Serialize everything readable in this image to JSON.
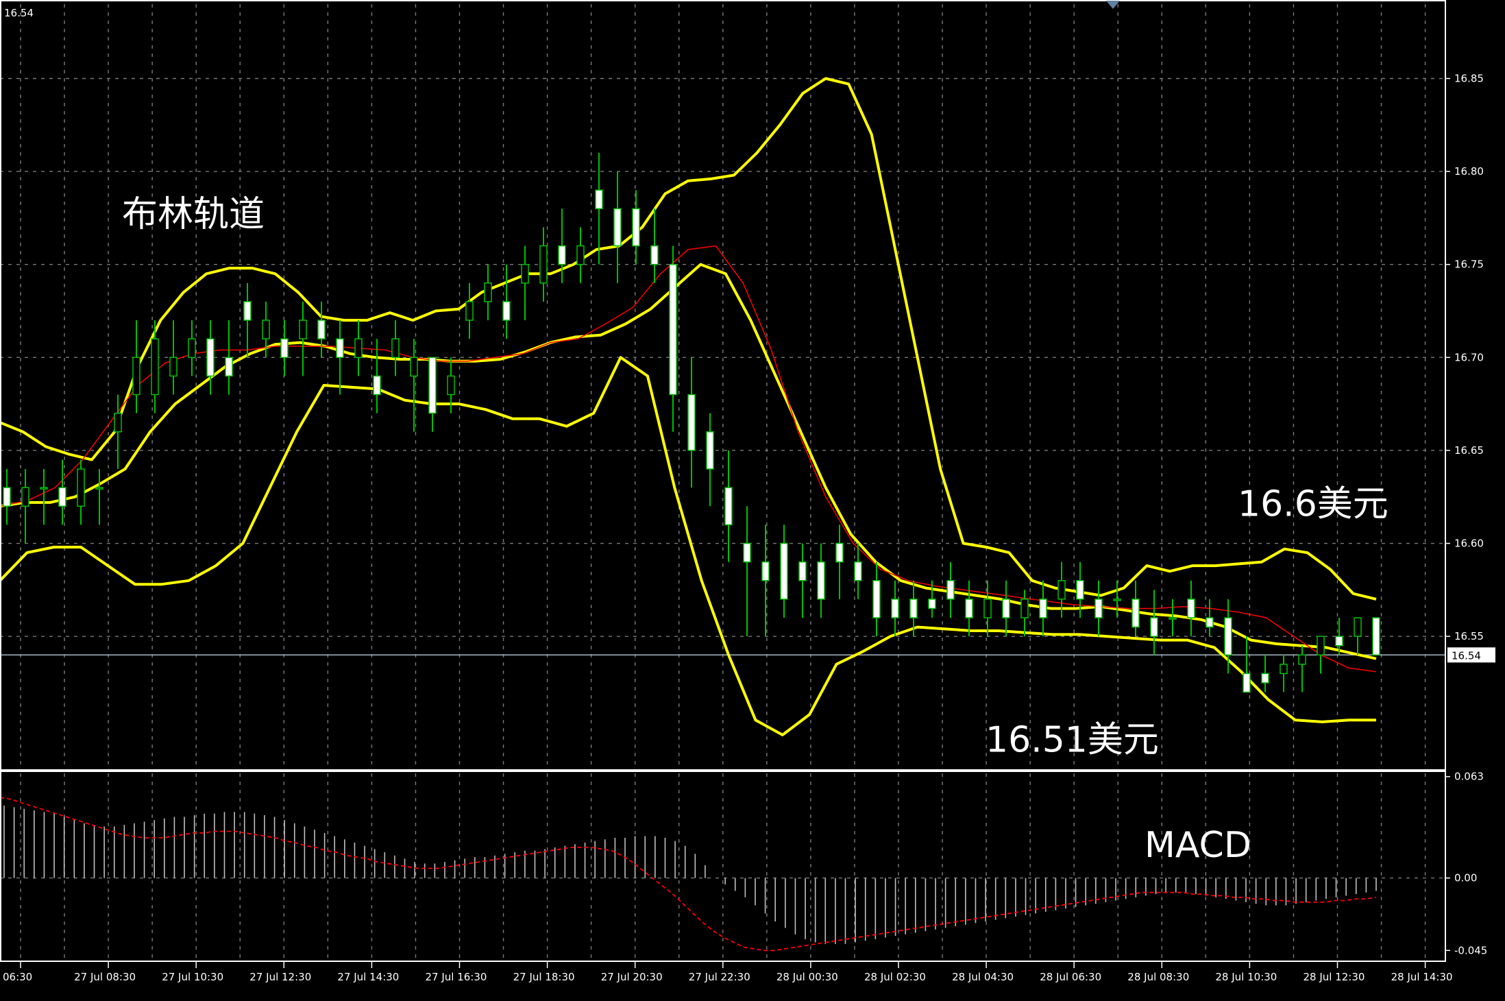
{
  "chart_data": [
    {
      "type": "candlestick",
      "panel": "price",
      "title": "布林轨道",
      "corner_price": "16.54",
      "current_price": 16.54,
      "current_price_label": "16.54",
      "ylim": [
        16.48,
        16.89
      ],
      "yticks": [
        16.55,
        16.6,
        16.65,
        16.7,
        16.75,
        16.8,
        16.85
      ],
      "ytick_labels": [
        "16.55",
        "16.60",
        "16.65",
        "16.70",
        "16.75",
        "16.80",
        "16.85"
      ],
      "xticks": [
        "06:30",
        "27 Jul 08:30",
        "27 Jul 10:30",
        "27 Jul 12:30",
        "27 Jul 14:30",
        "27 Jul 16:30",
        "27 Jul 18:30",
        "27 Jul 20:30",
        "27 Jul 22:30",
        "28 Jul 00:30",
        "28 Jul 02:30",
        "28 Jul 04:30",
        "28 Jul 06:30",
        "28 Jul 08:30",
        "28 Jul 10:30",
        "28 Jul 12:30",
        "28 Jul 14:30"
      ],
      "grid": true,
      "colors": {
        "candle": "#00c000",
        "candle_body_up": "#000000",
        "candle_body_down": "#ffffff",
        "bollinger": "#ffff00",
        "ma": "#ff0000",
        "grid": "#808080",
        "background": "#000000"
      },
      "annotations": [
        {
          "text": "16.6美元",
          "price": 16.6
        },
        {
          "text": "16.51美元",
          "price": 16.51
        }
      ],
      "bollinger_upper": [
        16.665,
        16.66,
        16.652,
        16.648,
        16.645,
        16.66,
        16.695,
        16.72,
        16.735,
        16.745,
        16.748,
        16.748,
        16.745,
        16.735,
        16.722,
        16.72,
        16.72,
        16.724,
        16.72,
        16.725,
        16.726,
        16.735,
        16.74,
        16.745,
        16.745,
        16.75,
        16.758,
        16.76,
        16.77,
        16.788,
        16.795,
        16.796,
        16.798,
        16.81,
        16.825,
        16.842,
        16.85,
        16.847,
        16.82,
        16.76,
        16.7,
        16.64,
        16.6,
        16.598,
        16.595,
        16.58,
        16.576,
        16.574,
        16.572,
        16.576,
        16.588,
        16.585,
        16.588,
        16.588,
        16.589,
        16.59,
        16.597,
        16.595,
        16.586,
        16.573,
        16.57
      ],
      "bollinger_middle": [
        16.62,
        16.622,
        16.622,
        16.625,
        16.632,
        16.64,
        16.66,
        16.675,
        16.685,
        16.695,
        16.702,
        16.707,
        16.708,
        16.706,
        16.702,
        16.7,
        16.699,
        16.699,
        16.698,
        16.698,
        16.699,
        16.703,
        16.708,
        16.711,
        16.712,
        16.718,
        16.726,
        16.738,
        16.75,
        16.745,
        16.72,
        16.69,
        16.66,
        16.63,
        16.605,
        16.59,
        16.58,
        16.576,
        16.574,
        16.572,
        16.57,
        16.567,
        16.565,
        16.565,
        16.566,
        16.564,
        16.562,
        16.561,
        16.559,
        16.555,
        16.548,
        16.546,
        16.545,
        16.544,
        16.541,
        16.538
      ],
      "bollinger_lower": [
        16.58,
        16.595,
        16.598,
        16.598,
        16.588,
        16.578,
        16.578,
        16.58,
        16.588,
        16.6,
        16.63,
        16.66,
        16.685,
        16.684,
        16.683,
        16.677,
        16.675,
        16.675,
        16.672,
        16.667,
        16.667,
        16.663,
        16.67,
        16.7,
        16.69,
        16.63,
        16.58,
        16.54,
        16.505,
        16.497,
        16.508,
        16.535,
        16.542,
        16.55,
        16.555,
        16.554,
        16.553,
        16.553,
        16.552,
        16.551,
        16.551,
        16.55,
        16.549,
        16.548,
        16.548,
        16.544,
        16.531,
        16.516,
        16.505,
        16.504,
        16.505,
        16.505
      ],
      "ma": [
        16.62,
        16.623,
        16.63,
        16.645,
        16.665,
        16.685,
        16.697,
        16.702,
        16.704,
        16.704,
        16.706,
        16.706,
        16.706,
        16.705,
        16.704,
        16.7,
        16.698,
        16.698,
        16.7,
        16.702,
        16.708,
        16.71,
        16.718,
        16.727,
        16.745,
        16.758,
        16.76,
        16.74,
        16.705,
        16.66,
        16.625,
        16.6,
        16.586,
        16.58,
        16.577,
        16.575,
        16.573,
        16.571,
        16.569,
        16.567,
        16.566,
        16.565,
        16.565,
        16.566,
        16.565,
        16.563,
        16.56,
        16.55,
        16.54,
        16.533,
        16.531
      ],
      "candles": [
        {
          "o": 16.63,
          "h": 16.64,
          "l": 16.61,
          "c": 16.62
        },
        {
          "o": 16.62,
          "h": 16.64,
          "l": 16.6,
          "c": 16.63
        },
        {
          "o": 16.63,
          "h": 16.64,
          "l": 16.61,
          "c": 16.63
        },
        {
          "o": 16.63,
          "h": 16.645,
          "l": 16.61,
          "c": 16.62
        },
        {
          "o": 16.62,
          "h": 16.645,
          "l": 16.61,
          "c": 16.64
        },
        {
          "o": 16.63,
          "h": 16.64,
          "l": 16.61,
          "c": 16.63
        },
        {
          "o": 16.66,
          "h": 16.68,
          "l": 16.64,
          "c": 16.67
        },
        {
          "o": 16.68,
          "h": 16.72,
          "l": 16.67,
          "c": 16.7
        },
        {
          "o": 16.68,
          "h": 16.72,
          "l": 16.67,
          "c": 16.71
        },
        {
          "o": 16.69,
          "h": 16.72,
          "l": 16.68,
          "c": 16.7
        },
        {
          "o": 16.7,
          "h": 16.72,
          "l": 16.69,
          "c": 16.71
        },
        {
          "o": 16.71,
          "h": 16.72,
          "l": 16.68,
          "c": 16.69
        },
        {
          "o": 16.7,
          "h": 16.72,
          "l": 16.68,
          "c": 16.69
        },
        {
          "o": 16.73,
          "h": 16.74,
          "l": 16.7,
          "c": 16.72
        },
        {
          "o": 16.71,
          "h": 16.73,
          "l": 16.7,
          "c": 16.72
        },
        {
          "o": 16.71,
          "h": 16.72,
          "l": 16.69,
          "c": 16.7
        },
        {
          "o": 16.71,
          "h": 16.73,
          "l": 16.69,
          "c": 16.72
        },
        {
          "o": 16.72,
          "h": 16.73,
          "l": 16.7,
          "c": 16.71
        },
        {
          "o": 16.71,
          "h": 16.72,
          "l": 16.68,
          "c": 16.7
        },
        {
          "o": 16.7,
          "h": 16.72,
          "l": 16.69,
          "c": 16.71
        },
        {
          "o": 16.69,
          "h": 16.71,
          "l": 16.67,
          "c": 16.68
        },
        {
          "o": 16.7,
          "h": 16.72,
          "l": 16.69,
          "c": 16.71
        },
        {
          "o": 16.69,
          "h": 16.71,
          "l": 16.66,
          "c": 16.7
        },
        {
          "o": 16.7,
          "h": 16.7,
          "l": 16.66,
          "c": 16.67
        },
        {
          "o": 16.68,
          "h": 16.7,
          "l": 16.67,
          "c": 16.69
        },
        {
          "o": 16.72,
          "h": 16.74,
          "l": 16.71,
          "c": 16.73
        },
        {
          "o": 16.73,
          "h": 16.75,
          "l": 16.72,
          "c": 16.74
        },
        {
          "o": 16.73,
          "h": 16.75,
          "l": 16.71,
          "c": 16.72
        },
        {
          "o": 16.74,
          "h": 16.76,
          "l": 16.72,
          "c": 16.75
        },
        {
          "o": 16.74,
          "h": 16.77,
          "l": 16.73,
          "c": 16.76
        },
        {
          "o": 16.76,
          "h": 16.78,
          "l": 16.74,
          "c": 16.75
        },
        {
          "o": 16.75,
          "h": 16.77,
          "l": 16.74,
          "c": 16.76
        },
        {
          "o": 16.79,
          "h": 16.81,
          "l": 16.75,
          "c": 16.78
        },
        {
          "o": 16.78,
          "h": 16.8,
          "l": 16.74,
          "c": 16.76
        },
        {
          "o": 16.78,
          "h": 16.79,
          "l": 16.75,
          "c": 16.76
        },
        {
          "o": 16.76,
          "h": 16.78,
          "l": 16.74,
          "c": 16.75
        },
        {
          "o": 16.75,
          "h": 16.76,
          "l": 16.66,
          "c": 16.68
        },
        {
          "o": 16.68,
          "h": 16.7,
          "l": 16.63,
          "c": 16.65
        },
        {
          "o": 16.66,
          "h": 16.67,
          "l": 16.62,
          "c": 16.64
        },
        {
          "o": 16.63,
          "h": 16.65,
          "l": 16.59,
          "c": 16.61
        },
        {
          "o": 16.6,
          "h": 16.62,
          "l": 16.55,
          "c": 16.59
        },
        {
          "o": 16.59,
          "h": 16.61,
          "l": 16.55,
          "c": 16.58
        },
        {
          "o": 16.6,
          "h": 16.61,
          "l": 16.56,
          "c": 16.57
        },
        {
          "o": 16.59,
          "h": 16.6,
          "l": 16.56,
          "c": 16.58
        },
        {
          "o": 16.59,
          "h": 16.6,
          "l": 16.56,
          "c": 16.57
        },
        {
          "o": 16.6,
          "h": 16.61,
          "l": 16.57,
          "c": 16.59
        },
        {
          "o": 16.59,
          "h": 16.6,
          "l": 16.57,
          "c": 16.58
        },
        {
          "o": 16.58,
          "h": 16.59,
          "l": 16.55,
          "c": 16.56
        },
        {
          "o": 16.57,
          "h": 16.58,
          "l": 16.55,
          "c": 16.56
        },
        {
          "o": 16.57,
          "h": 16.58,
          "l": 16.55,
          "c": 16.56
        },
        {
          "o": 16.57,
          "h": 16.58,
          "l": 16.56,
          "c": 16.565
        },
        {
          "o": 16.58,
          "h": 16.59,
          "l": 16.56,
          "c": 16.57
        },
        {
          "o": 16.57,
          "h": 16.58,
          "l": 16.55,
          "c": 16.56
        },
        {
          "o": 16.56,
          "h": 16.58,
          "l": 16.55,
          "c": 16.57
        },
        {
          "o": 16.57,
          "h": 16.58,
          "l": 16.55,
          "c": 16.56
        },
        {
          "o": 16.56,
          "h": 16.575,
          "l": 16.55,
          "c": 16.57
        },
        {
          "o": 16.57,
          "h": 16.58,
          "l": 16.55,
          "c": 16.56
        },
        {
          "o": 16.57,
          "h": 16.59,
          "l": 16.56,
          "c": 16.58
        },
        {
          "o": 16.58,
          "h": 16.59,
          "l": 16.56,
          "c": 16.57
        },
        {
          "o": 16.57,
          "h": 16.58,
          "l": 16.55,
          "c": 16.56
        },
        {
          "o": 16.57,
          "h": 16.58,
          "l": 16.56,
          "c": 16.57
        },
        {
          "o": 16.57,
          "h": 16.58,
          "l": 16.55,
          "c": 16.555
        },
        {
          "o": 16.56,
          "h": 16.575,
          "l": 16.54,
          "c": 16.55
        },
        {
          "o": 16.56,
          "h": 16.57,
          "l": 16.55,
          "c": 16.56
        },
        {
          "o": 16.57,
          "h": 16.58,
          "l": 16.55,
          "c": 16.56
        },
        {
          "o": 16.56,
          "h": 16.57,
          "l": 16.55,
          "c": 16.555
        },
        {
          "o": 16.56,
          "h": 16.57,
          "l": 16.53,
          "c": 16.54
        },
        {
          "o": 16.53,
          "h": 16.55,
          "l": 16.52,
          "c": 16.52
        },
        {
          "o": 16.53,
          "h": 16.54,
          "l": 16.52,
          "c": 16.525
        },
        {
          "o": 16.53,
          "h": 16.54,
          "l": 16.52,
          "c": 16.535
        },
        {
          "o": 16.535,
          "h": 16.545,
          "l": 16.52,
          "c": 16.54
        },
        {
          "o": 16.54,
          "h": 16.55,
          "l": 16.53,
          "c": 16.55
        },
        {
          "o": 16.55,
          "h": 16.56,
          "l": 16.54,
          "c": 16.545
        },
        {
          "o": 16.55,
          "h": 16.56,
          "l": 16.54,
          "c": 16.56
        },
        {
          "o": 16.56,
          "h": 16.56,
          "l": 16.54,
          "c": 16.54
        }
      ]
    },
    {
      "type": "bar",
      "panel": "macd",
      "title": "MACD",
      "ylim": [
        -0.05,
        0.065
      ],
      "yticks": [
        0.063,
        0.0,
        -0.045
      ],
      "ytick_labels": [
        "0.063",
        "0.00",
        "-0.045"
      ],
      "colors": {
        "histogram": "#c0c0c0",
        "signal": "#ff0000"
      },
      "histogram": [
        0.045,
        0.044,
        0.043,
        0.042,
        0.041,
        0.04,
        0.038,
        0.036,
        0.034,
        0.033,
        0.032,
        0.032,
        0.033,
        0.034,
        0.035,
        0.036,
        0.037,
        0.038,
        0.038,
        0.039,
        0.04,
        0.04,
        0.041,
        0.041,
        0.041,
        0.04,
        0.039,
        0.038,
        0.036,
        0.034,
        0.032,
        0.03,
        0.028,
        0.026,
        0.024,
        0.022,
        0.02,
        0.018,
        0.016,
        0.014,
        0.012,
        0.01,
        0.009,
        0.009,
        0.01,
        0.011,
        0.012,
        0.013,
        0.013,
        0.014,
        0.015,
        0.016,
        0.017,
        0.017,
        0.018,
        0.019,
        0.02,
        0.021,
        0.022,
        0.023,
        0.024,
        0.025,
        0.025,
        0.026,
        0.026,
        0.026,
        0.025,
        0.023,
        0.02,
        0.015,
        0.008,
        0.0,
        -0.004,
        -0.008,
        -0.012,
        -0.017,
        -0.022,
        -0.027,
        -0.031,
        -0.035,
        -0.038,
        -0.04,
        -0.041,
        -0.041,
        -0.041,
        -0.04,
        -0.039,
        -0.038,
        -0.037,
        -0.036,
        -0.035,
        -0.034,
        -0.033,
        -0.032,
        -0.031,
        -0.03,
        -0.029,
        -0.028,
        -0.027,
        -0.026,
        -0.025,
        -0.024,
        -0.023,
        -0.022,
        -0.021,
        -0.02,
        -0.019,
        -0.018,
        -0.017,
        -0.016,
        -0.015,
        -0.014,
        -0.013,
        -0.012,
        -0.011,
        -0.01,
        -0.009,
        -0.009,
        -0.009,
        -0.01,
        -0.011,
        -0.012,
        -0.013,
        -0.014,
        -0.015,
        -0.016,
        -0.017,
        -0.017,
        -0.017,
        -0.016,
        -0.015,
        -0.014,
        -0.013,
        -0.012,
        -0.011,
        -0.01,
        -0.009,
        -0.008
      ],
      "signal": [
        0.05,
        0.049,
        0.047,
        0.045,
        0.043,
        0.041,
        0.039,
        0.037,
        0.035,
        0.033,
        0.031,
        0.029,
        0.027,
        0.026,
        0.025,
        0.025,
        0.025,
        0.026,
        0.027,
        0.028,
        0.028,
        0.029,
        0.029,
        0.029,
        0.028,
        0.027,
        0.026,
        0.025,
        0.023,
        0.022,
        0.02,
        0.019,
        0.017,
        0.016,
        0.014,
        0.013,
        0.012,
        0.01,
        0.009,
        0.008,
        0.007,
        0.006,
        0.006,
        0.006,
        0.007,
        0.008,
        0.009,
        0.01,
        0.011,
        0.012,
        0.013,
        0.014,
        0.015,
        0.016,
        0.017,
        0.018,
        0.019,
        0.019,
        0.019,
        0.018,
        0.017,
        0.014,
        0.01,
        0.005,
        0.0,
        -0.005,
        -0.01,
        -0.016,
        -0.022,
        -0.028,
        -0.033,
        -0.037,
        -0.04,
        -0.043,
        -0.044,
        -0.045,
        -0.045,
        -0.044,
        -0.043,
        -0.042,
        -0.041,
        -0.04,
        -0.039,
        -0.038,
        -0.037,
        -0.036,
        -0.035,
        -0.034,
        -0.033,
        -0.032,
        -0.031,
        -0.03,
        -0.029,
        -0.028,
        -0.027,
        -0.026,
        -0.025,
        -0.024,
        -0.023,
        -0.022,
        -0.021,
        -0.02,
        -0.019,
        -0.018,
        -0.017,
        -0.016,
        -0.015,
        -0.014,
        -0.013,
        -0.012,
        -0.011,
        -0.01,
        -0.009,
        -0.009,
        -0.009,
        -0.009,
        -0.009,
        -0.01,
        -0.01,
        -0.011,
        -0.011,
        -0.012,
        -0.012,
        -0.013,
        -0.013,
        -0.014,
        -0.014,
        -0.015,
        -0.015,
        -0.015,
        -0.015,
        -0.014,
        -0.014,
        -0.013,
        -0.013,
        -0.012
      ]
    }
  ]
}
